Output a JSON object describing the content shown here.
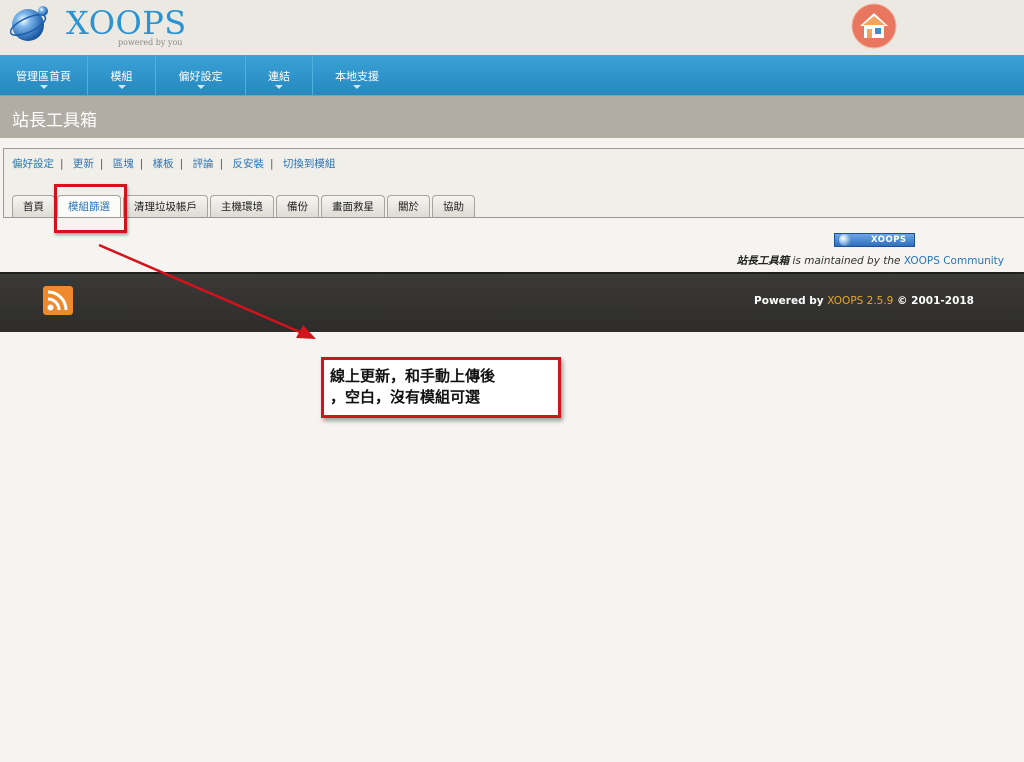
{
  "header": {
    "logo_text": "XOOPS",
    "logo_tagline": "powered by you",
    "home_icon": "home-icon"
  },
  "nav": [
    {
      "label": "管理區首頁"
    },
    {
      "label": "模組"
    },
    {
      "label": "偏好設定"
    },
    {
      "label": "連結"
    },
    {
      "label": "本地支援"
    }
  ],
  "page_title": "站長工具箱",
  "admin_links": [
    "偏好設定",
    "更新",
    "區塊",
    "樣板",
    "評論",
    "反安裝",
    "切換到模組"
  ],
  "tabs": [
    "首頁",
    "模組篩選",
    "清理垃圾帳戶",
    "主機環境",
    "備份",
    "畫面救星",
    "關於",
    "協助"
  ],
  "active_tab": "模組篩選",
  "maintained": {
    "badge": "XOOPS",
    "module": "站長工具箱",
    "middle": " is maintained by the ",
    "community": "XOOPS Community"
  },
  "footer": {
    "powered": "Powered by ",
    "version": "XOOPS 2.5.9",
    "copyright": " © 2001-2018",
    "rss_icon": "rss-icon"
  },
  "callout": {
    "line1": "線上更新，和手動上傳後",
    "line2": "，空白，沒有模組可選"
  },
  "colors": {
    "nav": "#2a93d4",
    "annotation": "#d4121b",
    "version": "#e8a82a"
  }
}
